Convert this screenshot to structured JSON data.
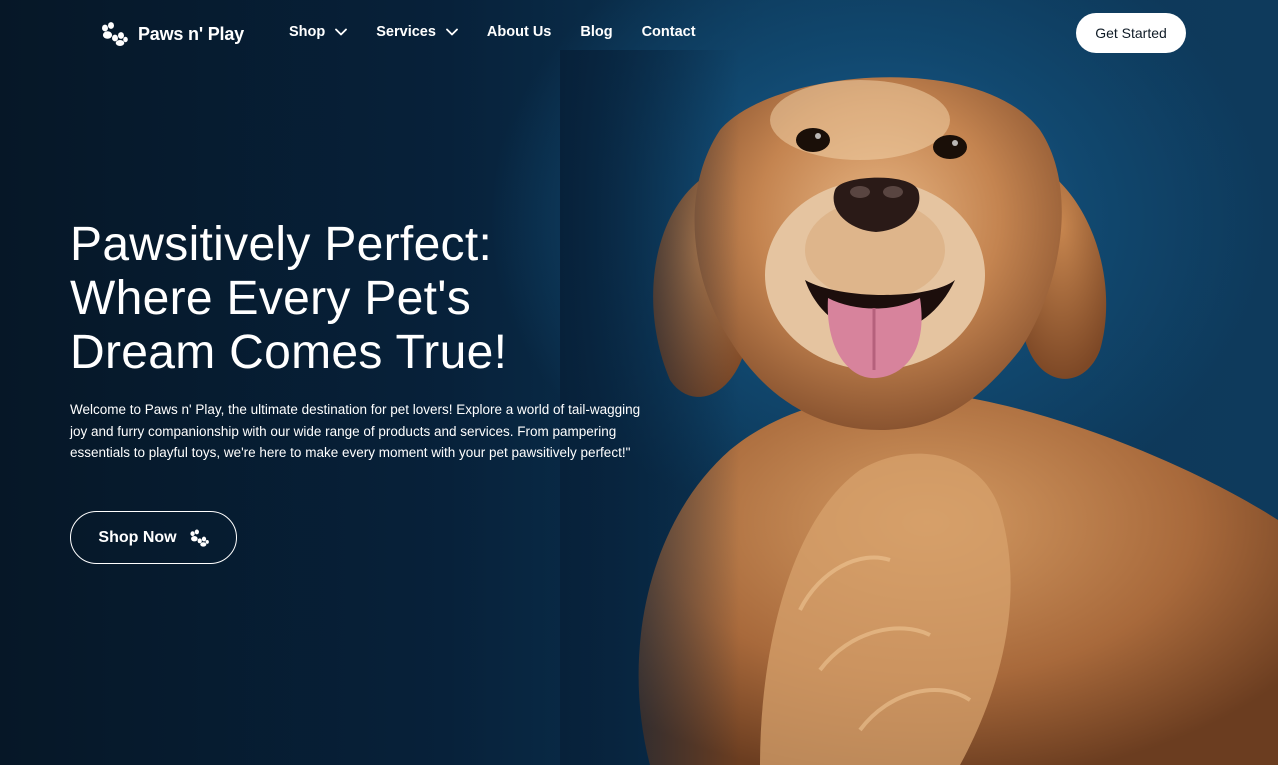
{
  "brand": {
    "name": "Paws n' Play",
    "icon": "paw-icon"
  },
  "nav": {
    "items": [
      {
        "label": "Shop",
        "has_dropdown": true,
        "icon": "chevron-down-icon"
      },
      {
        "label": "Services",
        "has_dropdown": true,
        "icon": "chevron-down-icon"
      },
      {
        "label": "About Us",
        "has_dropdown": false
      },
      {
        "label": "Blog",
        "has_dropdown": false
      },
      {
        "label": "Contact",
        "has_dropdown": false
      }
    ],
    "cta_label": "Get Started"
  },
  "hero": {
    "title_lines": [
      "Pawsitively Perfect:",
      "Where Every Pet's",
      "Dream Comes True!"
    ],
    "description": "Welcome to Paws n' Play, the ultimate destination for pet lovers! Explore a world of tail-wagging joy and furry companionship with our wide range of products and services. From pampering essentials to playful toys, we're here to make every moment with your pet pawsitively perfect!\"",
    "button_label": "Shop Now",
    "button_icon": "paw-icon"
  },
  "colors": {
    "background_dark": "#061727",
    "background_accent": "#1a5f93",
    "text": "#ffffff",
    "cta_text": "#0f1b26",
    "dog_fur": "#c98a52"
  }
}
